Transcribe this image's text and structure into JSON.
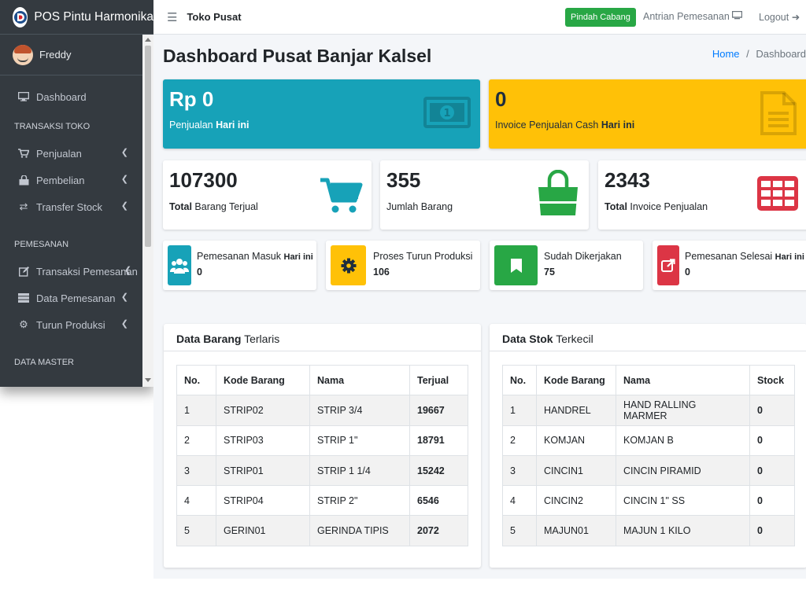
{
  "brand": {
    "name": "POS Pintu Harmonika"
  },
  "user": {
    "name": "Freddy"
  },
  "sidebar": {
    "items": [
      {
        "type": "item",
        "label": "Dashboard",
        "icon": "desktop-icon",
        "chevron": false
      },
      {
        "type": "header",
        "label": "TRANSAKSI TOKO"
      },
      {
        "type": "item",
        "label": "Penjualan",
        "icon": "cart-icon",
        "chevron": true
      },
      {
        "type": "item",
        "label": "Pembelian",
        "icon": "shopping-bag-icon",
        "chevron": true
      },
      {
        "type": "item",
        "label": "Transfer Stock",
        "icon": "exchange-icon",
        "chevron": true
      },
      {
        "type": "header",
        "label": "PEMESANAN"
      },
      {
        "type": "item",
        "label": "Transaksi Pemesanan",
        "icon": "edit-icon",
        "chevron": true
      },
      {
        "type": "item",
        "label": "Data Pemesanan",
        "icon": "database-icon",
        "chevron": true
      },
      {
        "type": "item",
        "label": "Turun Produksi",
        "icon": "cogs-icon",
        "chevron": true
      },
      {
        "type": "header",
        "label": "DATA MASTER"
      }
    ]
  },
  "topbar": {
    "store_name": "Toko Pusat",
    "branch_button": "Pindah Cabang",
    "queue_label": "Antrian Pemesanan",
    "logout_label": "Logout"
  },
  "page": {
    "title_prefix": "Dashboard",
    "title_bold": "Pusat Banjar Kalsel",
    "breadcrumb_home": "Home",
    "breadcrumb_sep": "/",
    "breadcrumb_current": "Dashboard"
  },
  "colors": {
    "info": "#17a2b8",
    "warning": "#ffc107",
    "success": "#28a745",
    "danger": "#dc3545",
    "sidebar": "#343a40"
  },
  "small_boxes": [
    {
      "value": "Rp 0",
      "label_plain": "Penjualan",
      "label_bold": "Hari ini",
      "icon": "money-bill-icon"
    },
    {
      "value": "0",
      "label_plain": "Invoice Penjualan Cash",
      "label_bold": "Hari ini",
      "icon": "file-alt-icon"
    }
  ],
  "stat_boxes": [
    {
      "value": "107300",
      "label_bold": "Total",
      "label_plain": "Barang Terjual",
      "icon": "cart-icon"
    },
    {
      "value": "355",
      "label_bold": "",
      "label_plain": "Jumlah Barang",
      "icon": "shopping-bag-icon"
    },
    {
      "value": "2343",
      "label_bold": "Total",
      "label_plain": "Invoice Penjualan",
      "icon": "table-icon"
    }
  ],
  "info_boxes": [
    {
      "title": "Pemesanan Masuk",
      "title_bold": "Hari ini",
      "number": "0",
      "icon": "users-icon"
    },
    {
      "title": "Proses Turun Produksi",
      "title_bold": "",
      "number": "106",
      "icon": "cog-icon"
    },
    {
      "title": "Sudah Dikerjakan",
      "title_bold": "",
      "number": "75",
      "icon": "bookmark-icon"
    },
    {
      "title": "Pemesanan Selesai",
      "title_bold": "Hari ini",
      "number": "0",
      "icon": "external-link-icon"
    }
  ],
  "tables": {
    "terlaris": {
      "title_bold": "Data Barang",
      "title_plain": "Terlaris",
      "headers": [
        "No.",
        "Kode Barang",
        "Nama",
        "Terjual"
      ],
      "rows": [
        [
          "1",
          "STRIP02",
          "STRIP 3/4",
          "19667"
        ],
        [
          "2",
          "STRIP03",
          "STRIP 1\"",
          "18791"
        ],
        [
          "3",
          "STRIP01",
          "STRIP 1 1/4",
          "15242"
        ],
        [
          "4",
          "STRIP04",
          "STRIP 2\"",
          "6546"
        ],
        [
          "5",
          "GERIN01",
          "GERINDA TIPIS",
          "2072"
        ]
      ]
    },
    "terkecil": {
      "title_bold": "Data Stok",
      "title_plain": "Terkecil",
      "headers": [
        "No.",
        "Kode Barang",
        "Nama",
        "Stock"
      ],
      "rows": [
        [
          "1",
          "HANDREL",
          "HAND RALLING MARMER",
          "0"
        ],
        [
          "2",
          "KOMJAN",
          "KOMJAN B",
          "0"
        ],
        [
          "3",
          "CINCIN1",
          "CINCIN PIRAMID",
          "0"
        ],
        [
          "4",
          "CINCIN2",
          "CINCIN 1\" SS",
          "0"
        ],
        [
          "5",
          "MAJUN01",
          "MAJUN 1 KILO",
          "0"
        ]
      ]
    }
  }
}
